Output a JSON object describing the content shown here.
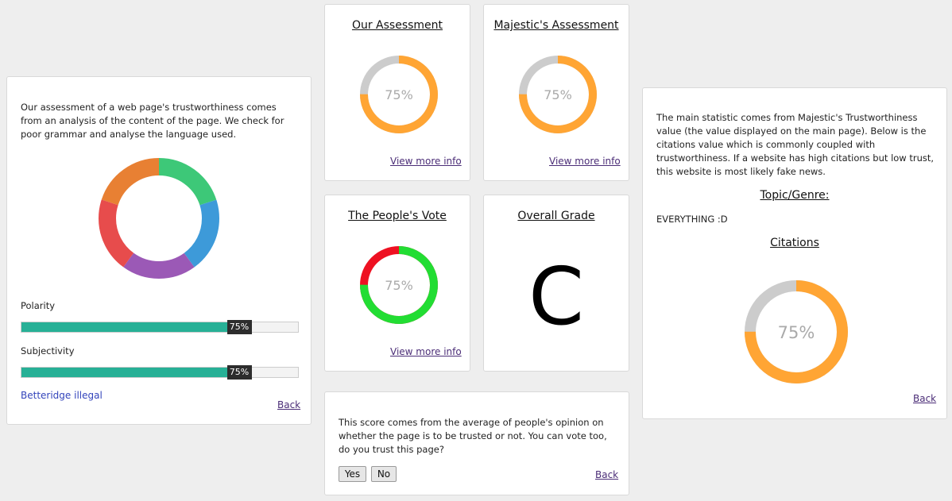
{
  "left_panel": {
    "intro": "Our assessment of a web page's trustworthiness comes from an analysis of the content of the page. We check for poor grammar and analyse the language used.",
    "polarity": {
      "label": "Polarity",
      "value": 75,
      "value_text": "75%"
    },
    "subjectivity": {
      "label": "Subjectivity",
      "value": 75,
      "value_text": "75%"
    },
    "betteridge_link": "Betteridge illegal",
    "back_link": "Back",
    "segment_colors": [
      "#3dc878",
      "#3d9ad9",
      "#9b59b6",
      "#e74c4c",
      "#e88033"
    ]
  },
  "our_assessment": {
    "title": "Our Assessment",
    "value": 75,
    "value_text": "75%",
    "link": "View more info",
    "fill_color": "#ffa534",
    "track_color": "#cccccc"
  },
  "majestic_assessment": {
    "title": "Majestic's Assessment",
    "value": 75,
    "value_text": "75%",
    "link": "View more info",
    "fill_color": "#ffa534",
    "track_color": "#cccccc"
  },
  "peoples_vote": {
    "title": "The People's Vote",
    "value": 75,
    "value_text": "75%",
    "link": "View more info",
    "fill_color": "#22dd33",
    "track_color": "#ee1122"
  },
  "overall_grade": {
    "title": "Overall Grade",
    "grade": "C"
  },
  "vote_panel": {
    "text": "This score comes from the average of people's opinion on whether the page is to be trusted or not. You can vote too, do you trust this page?",
    "yes_label": "Yes",
    "no_label": "No",
    "back_link": "Back"
  },
  "right_panel": {
    "intro": "The main statistic comes from Majestic's Trustworthiness value (the value displayed on the main page). Below is the citations value which is commonly coupled with trustworthiness. If a website has high citations but low trust, this website is most likely fake news.",
    "topic_heading": "Topic/Genre:",
    "topic_value": "EVERYTHING :D",
    "citations_heading": "Citations",
    "citations": {
      "value": 75,
      "value_text": "75%"
    },
    "back_link": "Back",
    "fill_color": "#ffa534",
    "track_color": "#cccccc"
  }
}
